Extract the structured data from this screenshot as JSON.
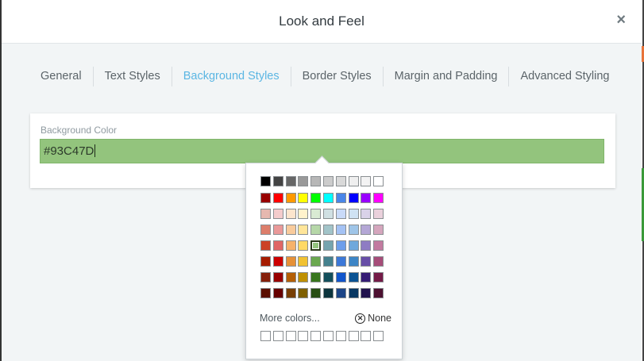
{
  "dialog": {
    "title": "Look and Feel",
    "close_symbol": "×"
  },
  "tabs": [
    {
      "label": "General",
      "active": false
    },
    {
      "label": "Text Styles",
      "active": false
    },
    {
      "label": "Background Styles",
      "active": true
    },
    {
      "label": "Border Styles",
      "active": false
    },
    {
      "label": "Margin and Padding",
      "active": false
    },
    {
      "label": "Advanced Styling",
      "active": false
    }
  ],
  "background_color": {
    "label": "Background Color",
    "value": "#93C47D"
  },
  "picker": {
    "selected_color": "#93C47D",
    "more_colors_label": "More colors...",
    "none_label": "None",
    "none_icon": "⊗",
    "palette": [
      [
        "#000000",
        "#434343",
        "#666666",
        "#999999",
        "#b7b7b7",
        "#cccccc",
        "#d9d9d9",
        "#efefef",
        "#f3f3f3",
        "#ffffff"
      ],
      [
        "#980000",
        "#ff0000",
        "#ff9900",
        "#ffff00",
        "#00ff00",
        "#00ffff",
        "#4a86e8",
        "#0000ff",
        "#9900ff",
        "#ff00ff"
      ],
      [
        "#e6b8af",
        "#f4cccc",
        "#fce5cd",
        "#fff2cc",
        "#d9ead3",
        "#d0e0e3",
        "#c9daf8",
        "#cfe2f3",
        "#d9d2e9",
        "#ead1dc"
      ],
      [
        "#dd7e6b",
        "#ea9999",
        "#f9cb9c",
        "#ffe599",
        "#b6d7a8",
        "#a2c4c9",
        "#a4c2f4",
        "#9fc5e8",
        "#b4a7d6",
        "#d5a6bd"
      ],
      [
        "#cc4125",
        "#e06666",
        "#f6b26b",
        "#ffd966",
        "#93c47d",
        "#76a5af",
        "#6d9eeb",
        "#6fa8dc",
        "#8e7cc3",
        "#c27ba0"
      ],
      [
        "#a61c00",
        "#cc0000",
        "#e69138",
        "#f1c232",
        "#6aa84f",
        "#45818e",
        "#3c78d8",
        "#3d85c6",
        "#674ea7",
        "#a64d79"
      ],
      [
        "#85200c",
        "#990000",
        "#b45f06",
        "#bf9000",
        "#38761d",
        "#134f5c",
        "#1155cc",
        "#0b5394",
        "#351c75",
        "#741b47"
      ],
      [
        "#5b0f00",
        "#660000",
        "#783f04",
        "#7f6000",
        "#274e13",
        "#0c343d",
        "#1c4587",
        "#073763",
        "#20124d",
        "#4c1130"
      ]
    ],
    "custom_slots": 10
  },
  "colors": {
    "accent_tab": "#5bb6e3",
    "edge_orange": "#e8733a",
    "edge_green": "#3a9a3a"
  }
}
